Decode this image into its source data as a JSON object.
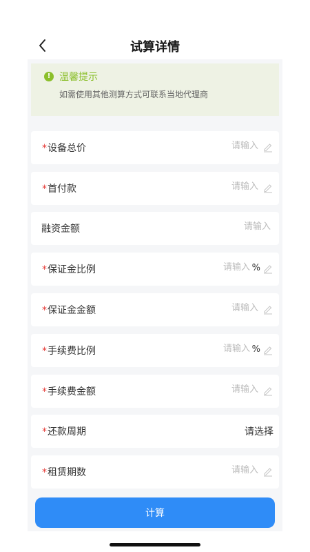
{
  "header": {
    "title": "试算详情"
  },
  "notice": {
    "title": "温馨提示",
    "text": "如需使用其他测算方式可联系当地代理商"
  },
  "form": {
    "placeholder": "请输入",
    "rows": [
      {
        "label": "设备总价",
        "required": "*"
      },
      {
        "label": "首付款",
        "required": "*"
      },
      {
        "label": "融资金额"
      },
      {
        "label": "保证金比例",
        "required": "*",
        "unit": "%"
      },
      {
        "label": "保证金金额",
        "required": "*"
      },
      {
        "label": "手续费比例",
        "required": "*",
        "unit": "%"
      },
      {
        "label": "手续费金额",
        "required": "*"
      },
      {
        "label": "还款周期",
        "required": "*",
        "select_value": "请选择"
      },
      {
        "label": "租赁期数",
        "required": "*"
      }
    ]
  },
  "actions": {
    "calculate_label": "计算"
  },
  "colors": {
    "accent": "#2f8cf7",
    "notice_green": "#8bbf2b",
    "required_red": "#e53935"
  }
}
